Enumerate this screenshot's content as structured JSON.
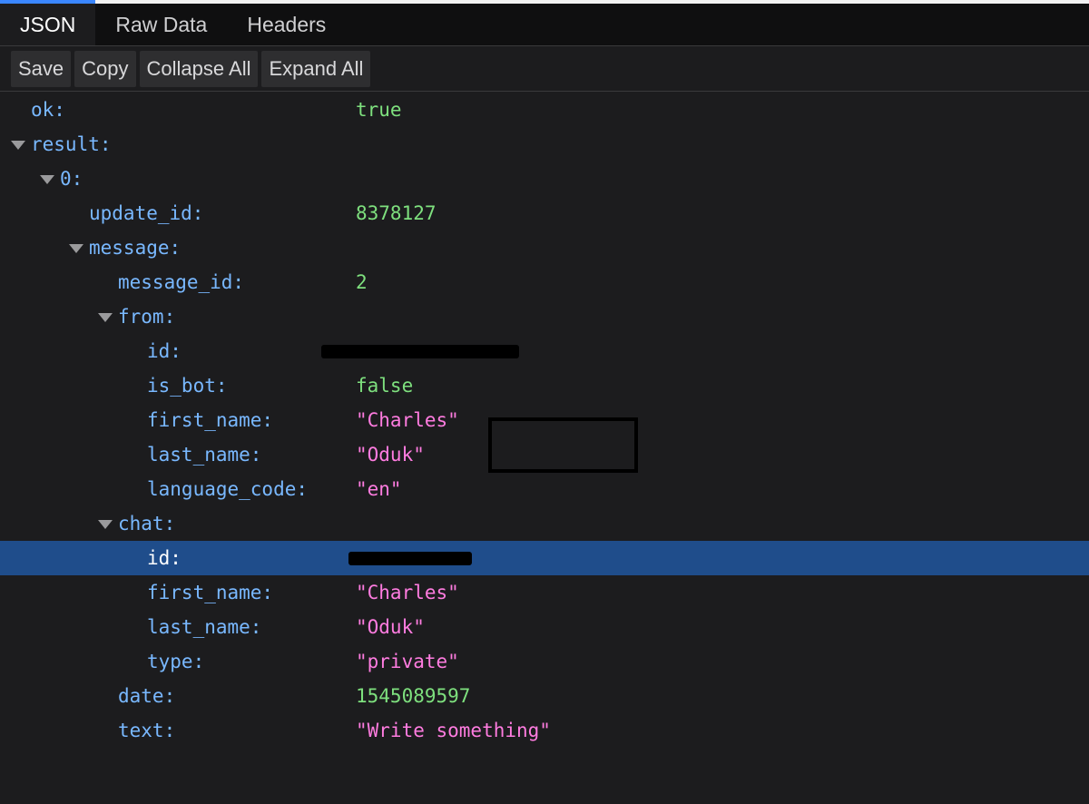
{
  "tabs": [
    "JSON",
    "Raw Data",
    "Headers"
  ],
  "toolbar": {
    "save": "Save",
    "copy": "Copy",
    "collapse_all": "Collapse All",
    "expand_all": "Expand All"
  },
  "rows": {
    "ok": {
      "key": "ok:",
      "value": "true"
    },
    "result": {
      "key": "result:"
    },
    "item0": {
      "key": "0:"
    },
    "update_id": {
      "key": "update_id:",
      "value": "8378127"
    },
    "message": {
      "key": "message:"
    },
    "message_id": {
      "key": "message_id:",
      "value": "2"
    },
    "from": {
      "key": "from:"
    },
    "from_id": {
      "key": "id:"
    },
    "from_is_bot": {
      "key": "is_bot:",
      "value": "false"
    },
    "from_first_name": {
      "key": "first_name:",
      "value": "\"Charles\""
    },
    "from_last_name": {
      "key": "last_name:",
      "value": "\"Oduk\""
    },
    "from_language_code": {
      "key": "language_code:",
      "value": "\"en\""
    },
    "chat": {
      "key": "chat:"
    },
    "chat_id": {
      "key": "id:"
    },
    "chat_first_name": {
      "key": "first_name:",
      "value": "\"Charles\""
    },
    "chat_last_name": {
      "key": "last_name:",
      "value": "\"Oduk\""
    },
    "chat_type": {
      "key": "type:",
      "value": "\"private\""
    },
    "date": {
      "key": "date:",
      "value": "1545089597"
    },
    "text": {
      "key": "text:",
      "value": "\"Write something\""
    }
  },
  "icons": {
    "toggle": "triangle-down-icon"
  },
  "colors": {
    "key": "#79b8ff",
    "number": "#7ee07e",
    "string": "#ff7ce0",
    "selection": "#1f4d8b",
    "accent": "#3a86ff"
  }
}
